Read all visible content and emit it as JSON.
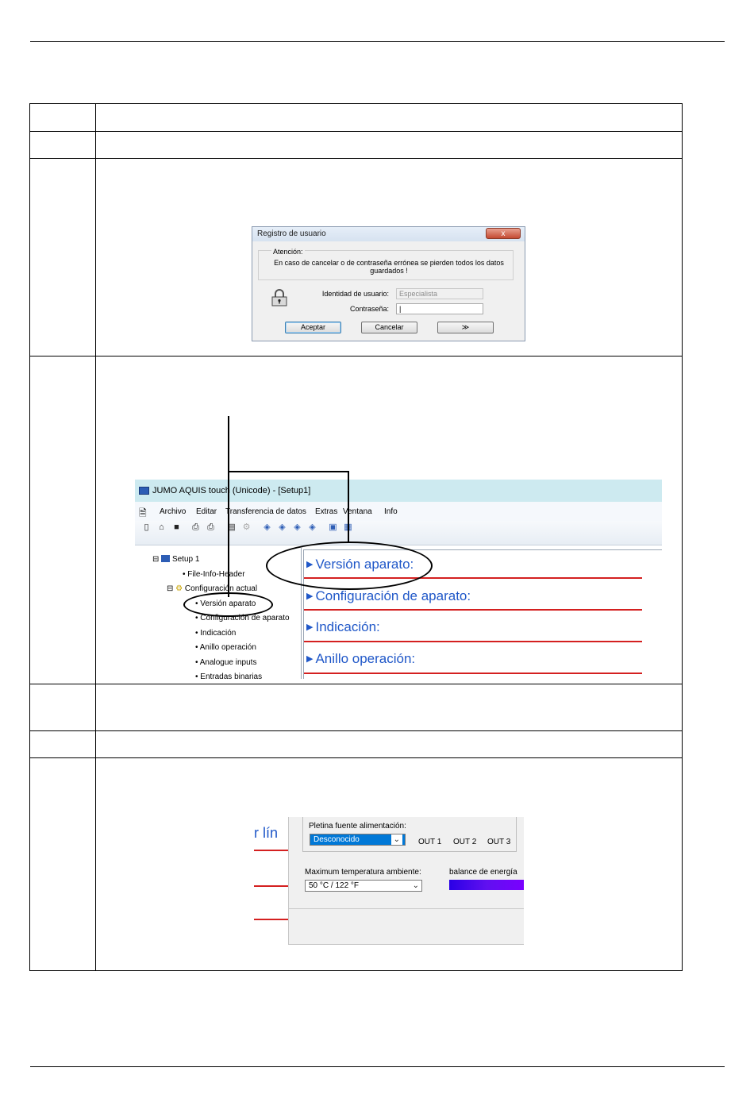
{
  "dialog": {
    "title": "Registro de usuario",
    "close_label": "x",
    "group_label": "Atención:",
    "message": "En caso de cancelar o de contraseña errónea se pierden todos los datos guardados !",
    "user_label": "Identidad de usuario:",
    "user_value": "Especialista",
    "password_label": "Contraseña:",
    "password_value": "|",
    "ok_label": "Aceptar",
    "cancel_label": "Cancelar",
    "expand_label": "≫"
  },
  "app": {
    "title": "JUMO AQUIS touch (Unicode) - [Setup1]",
    "menu": [
      "Archivo",
      "Editar",
      "Transferencia de datos",
      "Extras",
      "Ventana",
      "Info"
    ],
    "toolbar_icons": [
      "new-file-icon",
      "open-folder-icon",
      "save-icon",
      "print-preview-icon",
      "print-icon",
      "sheet-icon",
      "gear-disabled-icon",
      "transfer-up-icon",
      "transfer-down-icon",
      "transfer-left-icon",
      "transfer-right-icon",
      "monitor-icon",
      "grid-icon"
    ],
    "tree": {
      "root": "Setup 1",
      "file_info": "File-Info-Header",
      "config": "Configuración actual",
      "children": [
        "Versión aparato",
        "Configuración de aparato",
        "Indicación",
        "Anillo operación",
        "Analogue inputs",
        "Entradas binarias"
      ]
    },
    "sections": [
      "Versión aparato:",
      "Configuración de aparato:",
      "Indicación:",
      "Anillo operación:"
    ]
  },
  "crop2": {
    "fragment_text": "r lín",
    "power_label": "Pletina fuente alimentación:",
    "power_value": "Desconocido",
    "outputs": [
      "OUT 1",
      "OUT 2",
      "OUT 3"
    ],
    "temp_label": "Maximum temperatura ambiente:",
    "temp_value": "50 °C / 122 °F",
    "energy_label": "balance de energía"
  },
  "colors": {
    "accent_blue": "#1f57c8",
    "red_line": "#d42020",
    "highlight": "#0078d7",
    "titlebar": "#cdeaf0"
  }
}
